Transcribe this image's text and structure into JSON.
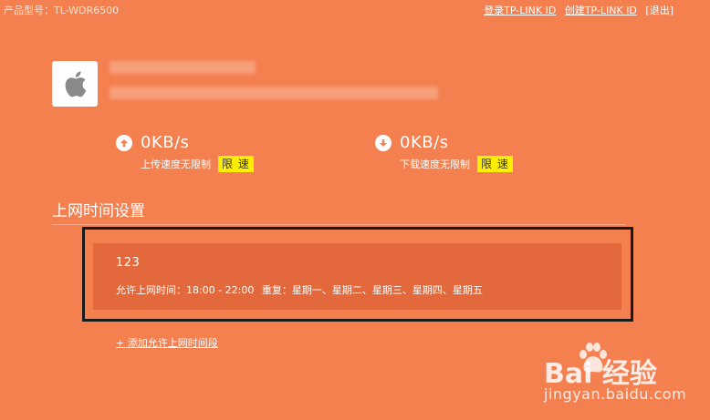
{
  "header": {
    "product_model": "产品型号：TL-WDR6500",
    "login": "登录TP-LINK ID",
    "create": "创建TP-LINK ID",
    "logout": "[退出]"
  },
  "device": {
    "icon": "apple-icon"
  },
  "upload": {
    "value": "0KB/s",
    "status": "上传速度无限制",
    "limit_label": "限 速",
    "icon": "arrow-up-icon"
  },
  "download": {
    "value": "0KB/s",
    "status": "下载速度无限制",
    "limit_label": "限 速",
    "icon": "arrow-down-icon"
  },
  "section": {
    "title": "上网时间设置"
  },
  "schedule": {
    "name": "123",
    "time_label": "允许上网时间：18:00 - 22:00",
    "repeat_label": "重复：星期一、星期二、星期三、星期四、星期五"
  },
  "add_link": "+ 添加允许上网时间段",
  "watermark": {
    "main": "Bai  经验",
    "sub": "jingyan.baidu.com"
  },
  "colors": {
    "background": "#f47f4f",
    "card": "#e3693d",
    "limit_button": "#ffee00",
    "frame": "#1a1a1a"
  }
}
